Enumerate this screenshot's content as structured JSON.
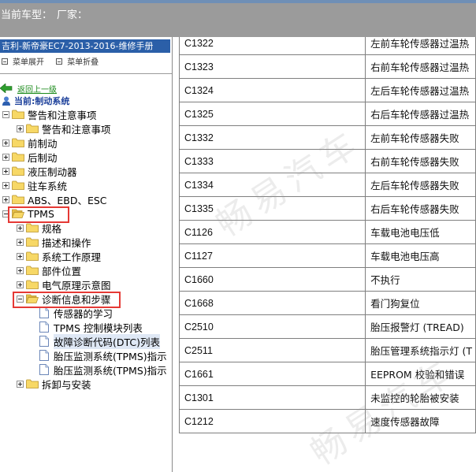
{
  "header": {
    "vehicle_label": "当前车型：",
    "manufacturer_label": "厂家："
  },
  "sidebar": {
    "manual_title": "吉利-新帝豪EC7-2013-2016-维修手册",
    "expand_label": "菜单展开",
    "collapse_label": "菜单折叠",
    "back_label": "返回上一级",
    "current_label": "当前:制动系统",
    "tree": [
      {
        "label": "警告和注意事项",
        "level": 0,
        "expander": "minus",
        "icon": "folder"
      },
      {
        "label": "警告和注意事项",
        "level": 1,
        "expander": "plus",
        "icon": "folder"
      },
      {
        "label": "前制动",
        "level": 0,
        "expander": "plus",
        "icon": "folder"
      },
      {
        "label": "后制动",
        "level": 0,
        "expander": "plus",
        "icon": "folder"
      },
      {
        "label": "液压制动器",
        "level": 0,
        "expander": "plus",
        "icon": "folder"
      },
      {
        "label": "驻车系统",
        "level": 0,
        "expander": "plus",
        "icon": "folder"
      },
      {
        "label": "ABS、EBD、ESC",
        "level": 0,
        "expander": "plus",
        "icon": "folder"
      },
      {
        "label": "TPMS",
        "level": 0,
        "expander": "minus",
        "icon": "folder-open"
      },
      {
        "label": "规格",
        "level": 1,
        "expander": "plus",
        "icon": "folder"
      },
      {
        "label": "描述和操作",
        "level": 1,
        "expander": "plus",
        "icon": "folder"
      },
      {
        "label": "系统工作原理",
        "level": 1,
        "expander": "plus",
        "icon": "folder"
      },
      {
        "label": "部件位置",
        "level": 1,
        "expander": "plus",
        "icon": "folder"
      },
      {
        "label": "电气原理示意图",
        "level": 1,
        "expander": "plus",
        "icon": "folder"
      },
      {
        "label": "诊断信息和步骤",
        "level": 1,
        "expander": "minus",
        "icon": "folder-open"
      },
      {
        "label": "传感器的学习",
        "level": 2,
        "expander": "none",
        "icon": "doc"
      },
      {
        "label": "TPMS 控制模块列表",
        "level": 2,
        "expander": "none",
        "icon": "doc"
      },
      {
        "label": "故障诊断代码(DTC)列表",
        "level": 2,
        "expander": "none",
        "icon": "doc",
        "selected": true
      },
      {
        "label": "胎压监测系统(TPMS)指示",
        "level": 2,
        "expander": "none",
        "icon": "doc"
      },
      {
        "label": "胎压监测系统(TPMS)指示",
        "level": 2,
        "expander": "none",
        "icon": "doc"
      },
      {
        "label": "拆卸与安装",
        "level": 1,
        "expander": "plus",
        "icon": "folder"
      }
    ]
  },
  "dtc_table": {
    "rows": [
      {
        "code": "C1322",
        "description": "左前车轮传感器过温热"
      },
      {
        "code": "C1323",
        "description": "右前车轮传感器过温热"
      },
      {
        "code": "C1324",
        "description": "左后车轮传感器过温热"
      },
      {
        "code": "C1325",
        "description": "右后车轮传感器过温热"
      },
      {
        "code": "C1332",
        "description": "左前车轮传感器失败"
      },
      {
        "code": "C1333",
        "description": "右前车轮传感器失败"
      },
      {
        "code": "C1334",
        "description": "左后车轮传感器失败"
      },
      {
        "code": "C1335",
        "description": "右后车轮传感器失败"
      },
      {
        "code": "C1126",
        "description": "车载电池电压低"
      },
      {
        "code": "C1127",
        "description": "车载电池电压高"
      },
      {
        "code": "C1660",
        "description": "不执行"
      },
      {
        "code": "C1668",
        "description": "看门狗复位"
      },
      {
        "code": "C2510",
        "description": "胎压报警灯 (TREAD)"
      },
      {
        "code": "C2511",
        "description": "胎压管理系统指示灯 (T"
      },
      {
        "code": "C1661",
        "description": "EEPROM 校验和错误"
      },
      {
        "code": "C1301",
        "description": "未监控的轮胎被安装"
      },
      {
        "code": "C1212",
        "description": "速度传感器故障"
      }
    ]
  },
  "colors": {
    "title_bar": "#2b5fa8",
    "highlight_box": "#e53935",
    "back_link": "#1a8a1a",
    "current_label": "#1b3f9a",
    "top_bar": "#9b9b9b"
  }
}
